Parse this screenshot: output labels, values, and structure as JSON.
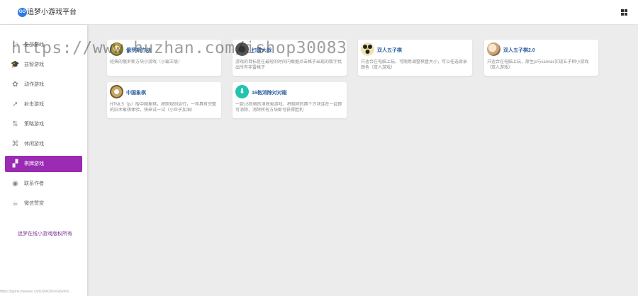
{
  "header": {
    "logo_text": "GO",
    "brand": "追梦小游戏平台"
  },
  "sidebar": {
    "items": [
      {
        "icon": "□",
        "label": "全部游戏",
        "active": false
      },
      {
        "icon": "🎓",
        "label": "益智游戏",
        "active": false
      },
      {
        "icon": "✿",
        "label": "动作游戏",
        "active": false
      },
      {
        "icon": "➚",
        "label": "射击游戏",
        "active": false
      },
      {
        "icon": "⇅",
        "label": "策略游戏",
        "active": false
      },
      {
        "icon": "⌘",
        "label": "休闲游戏",
        "active": false
      },
      {
        "icon": "▞",
        "label": "棋牌游戏",
        "active": true
      },
      {
        "icon": "◉",
        "label": "联系作者",
        "active": false
      },
      {
        "icon": "☕",
        "label": "微信赞赏",
        "active": false
      }
    ],
    "copyright": "追梦在线小游戏版权所有"
  },
  "cards": [
    {
      "title": "俄罗斯方块",
      "desc": "经典的俄罗斯方块小游戏（小霸王版）"
    },
    {
      "title": "扫雷大战",
      "desc": "游戏的目标是在最短的时间内根据点击格子出现的数字找出所有非雷格子"
    },
    {
      "title": "双人五子棋",
      "desc": "只适合在电脑上玩，可随意调整棋盘大小，可以任选背景颜色（双人游戏）"
    },
    {
      "title": "双人五子棋2.0",
      "desc": "只适合在电脑上玩，原生js与canvas实现五子棋小游戏（双人游戏）"
    },
    {
      "title": "中国象棋",
      "desc": "HTML5（js）版中国象棋，按照规则运行，一样具有完整的旧木象棋体验，快来试一试（小伙子加油）"
    },
    {
      "title": "16格消除对对碰",
      "desc": "一款16宫格的消除类游戏，将相同的两个方块连在一起即可消除，消除所有方块即可获得胜利"
    }
  ],
  "watermark": "https://www.huzhan.com/ishop30083",
  "statusbar": "https://game.meeyoo.cn/Uxzi6Oiho/Gi6xhrd..."
}
